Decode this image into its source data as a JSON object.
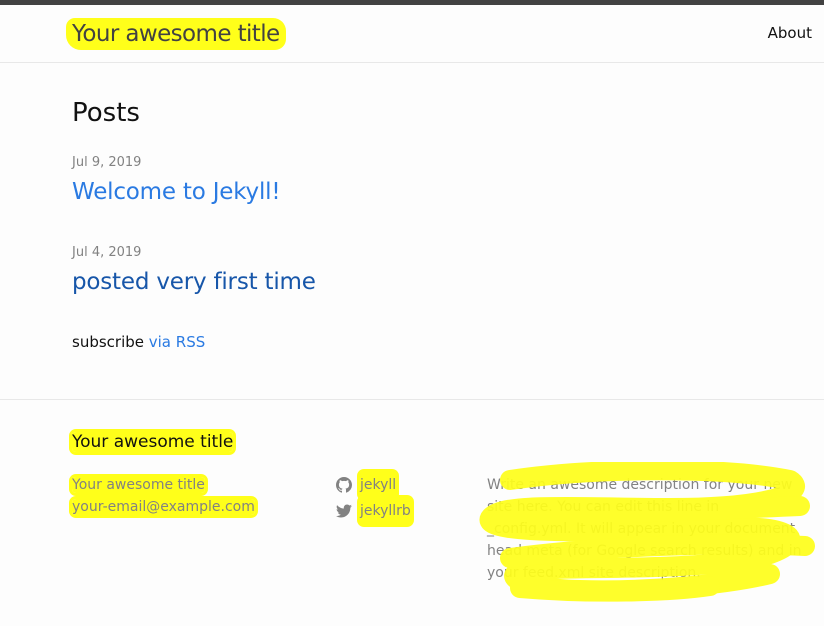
{
  "header": {
    "site_title": "Your awesome title",
    "nav_about": "About"
  },
  "main": {
    "heading": "Posts",
    "posts": [
      {
        "date": "Jul 9, 2019",
        "title": "Welcome to Jekyll!"
      },
      {
        "date": "Jul 4, 2019",
        "title": "posted very first time"
      }
    ],
    "subscribe_prefix": "subscribe ",
    "subscribe_link": "via RSS"
  },
  "footer": {
    "heading": "Your awesome title",
    "contact_name": "Your awesome title",
    "contact_email": "your-email@example.com",
    "github_user": "jekyll",
    "twitter_user": "jekyllrb",
    "description": "Write an awesome description for your new site here. You can edit this line in _config.yml. It will appear in your document head meta (for Google search results) and in your feed.xml site description."
  },
  "colors": {
    "highlight": "#ffff1a",
    "link": "#2a7ae2",
    "muted": "#828282"
  }
}
